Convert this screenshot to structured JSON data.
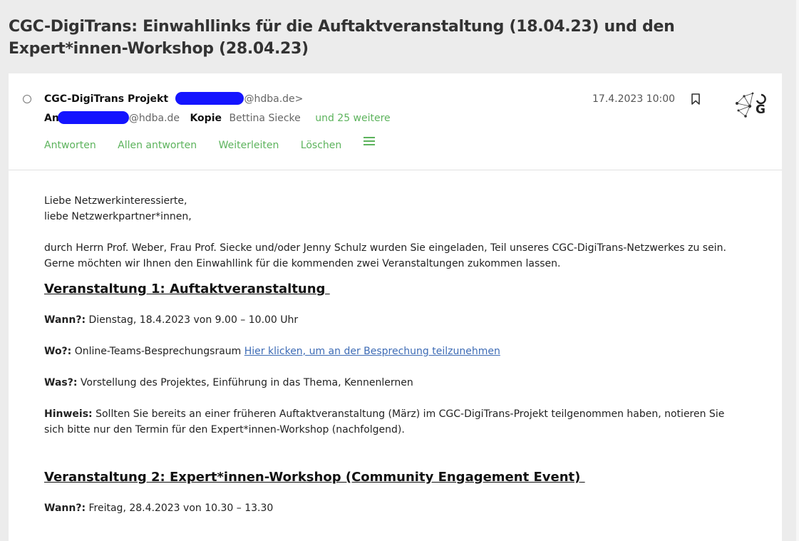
{
  "subject": "CGC-DigiTrans: Einwahllinks für die Auftaktveranstaltung (18.04.23) und den Expert*innen-Workshop (28.04.23)",
  "email": {
    "sender_name": "CGC-DigiTrans Projekt",
    "sender_email_suffix": "@hdba.de>",
    "to_label": "An",
    "to_suffix": "@hdba.de",
    "cc_label": "Kopie",
    "cc_name": "Bettina Siecke",
    "more_link": "und 25 weitere",
    "date": "17.4.2023 10:00",
    "redaction_color": "#1414ff",
    "icons": [
      "bookmark-icon",
      "menu-icon",
      "sender-logo"
    ]
  },
  "actions": [
    "Antworten",
    "Allen antworten",
    "Weiterleiten",
    "Löschen"
  ],
  "body": {
    "greeting1": "Liebe Netzwerkinteressierte,",
    "greeting2": "liebe Netzwerkpartner*innen,",
    "intro1": "durch Herrn Prof. Weber, Frau Prof. Siecke und/oder Jenny Schulz wurden Sie eingeladen, Teil unseres CGC-DigiTrans-Netzwerkes zu sein.",
    "intro2": "Gerne möchten wir Ihnen den Einwahllink für die kommenden zwei Veranstaltungen zukommen lassen.",
    "event1": {
      "heading": "Veranstaltung 1: Auftaktveranstaltung",
      "wann_label": "Wann?:",
      "wann_value": " Dienstag, 18.4.2023 von 9.00 – 10.00 Uhr",
      "wo_label": "Wo?:",
      "wo_value": " Online-Teams-Besprechungsraum ",
      "wo_link": "Hier klicken, um an der Besprechung teilzunehmen",
      "was_label": "Was?:",
      "was_value": " Vorstellung des Projektes, Einführung in das Thema, Kennenlernen",
      "hinweis_label": "Hinweis:",
      "hinweis_value1": " Sollten Sie bereits an einer früheren Auftaktveranstaltung (März) im CGC-DigiTrans-Projekt teilgenommen haben, notieren Sie",
      "hinweis_value2": "sich bitte nur den Termin für den Expert*innen-Workshop (nachfolgend)."
    },
    "event2": {
      "heading": "Veranstaltung 2: Expert*innen-Workshop (Community Engagement Event)",
      "wann_label": "Wann?:",
      "wann_value": " Freitag, 28.4.2023 von 10.30 – 13.30"
    }
  },
  "colors": {
    "accent_green": "#5cb35c",
    "link_blue": "#3d6bb5",
    "background": "#ececec"
  }
}
